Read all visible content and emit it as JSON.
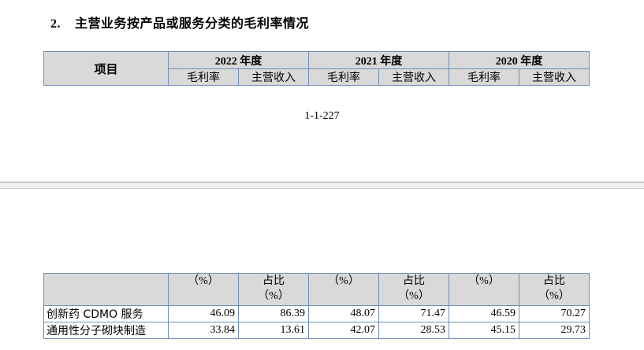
{
  "page1": {
    "section_number": "2.",
    "section_title": "主营业务按产品或服务分类的毛利率情况",
    "header": {
      "item_label": "项目",
      "years": [
        "2022 年度",
        "2021 年度",
        "2020 年度"
      ],
      "sub_columns": [
        "毛利率",
        "主营收入"
      ]
    },
    "page_number": "1-1-227"
  },
  "page2": {
    "header": {
      "col_gross": "（%）",
      "col_share_line1": "占比",
      "col_share_line2": "（%）"
    },
    "rows": [
      {
        "label": "创新药 CDMO 服务",
        "values": [
          "46.09",
          "86.39",
          "48.07",
          "71.47",
          "46.59",
          "70.27"
        ]
      },
      {
        "label": "通用性分子砌块制造",
        "values": [
          "33.84",
          "13.61",
          "42.07",
          "28.53",
          "45.15",
          "29.73"
        ]
      }
    ]
  }
}
